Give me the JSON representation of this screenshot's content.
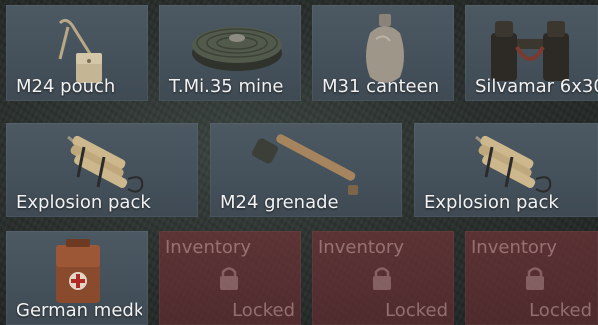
{
  "inventory": {
    "items": [
      {
        "label": "M24 pouch",
        "icon": "pouch-icon"
      },
      {
        "label": "T.Mi.35 mine",
        "icon": "mine-icon"
      },
      {
        "label": "M31 canteen",
        "icon": "canteen-icon"
      },
      {
        "label": "Silvamar 6x30",
        "icon": "binoculars-icon"
      },
      {
        "label": "Explosion pack",
        "icon": "explosion-pack-icon"
      },
      {
        "label": "M24 grenade",
        "icon": "grenade-icon"
      },
      {
        "label": "Explosion pack",
        "icon": "explosion-pack-icon"
      },
      {
        "label": "German medkit",
        "icon": "medkit-icon"
      }
    ],
    "locked_slots": [
      {
        "title": "Inventory",
        "status": "Locked"
      },
      {
        "title": "Inventory",
        "status": "Locked"
      },
      {
        "title": "Inventory",
        "status": "Locked"
      }
    ]
  },
  "colors": {
    "slot_bg": "#46525c",
    "locked_bg": "#6e3438",
    "label_text": "#f2f2f2"
  }
}
